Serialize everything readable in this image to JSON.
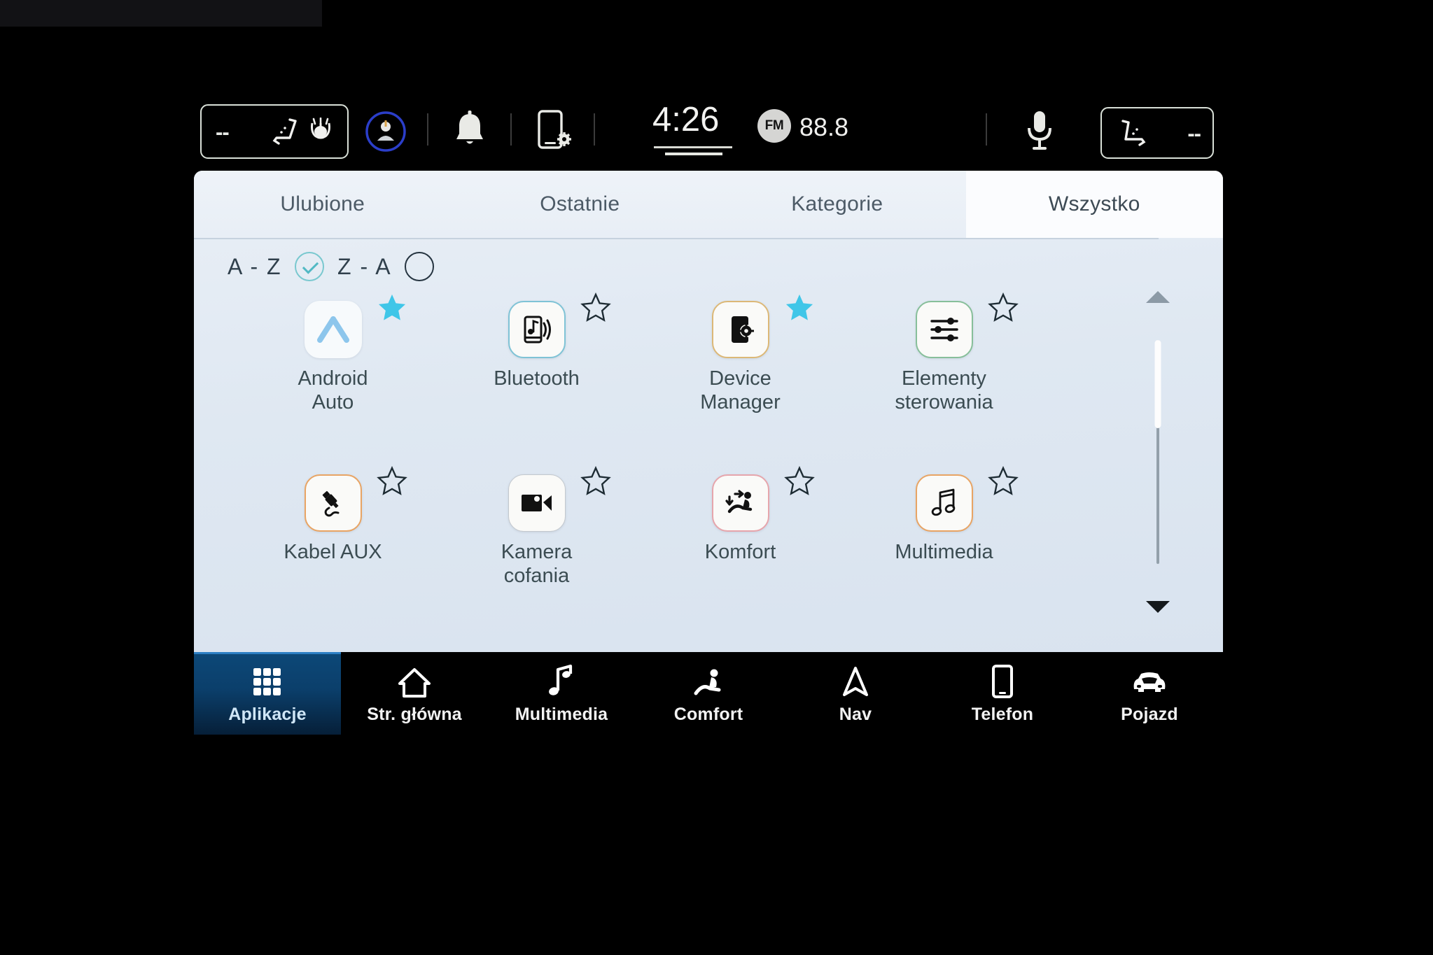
{
  "status_bar": {
    "left_seat_value": "--",
    "right_seat_value": "--",
    "left_seat_icon": "seat-heat-icon",
    "left_fan_icon": "seat-fan-icon",
    "profile_icon": "user-profile-icon",
    "bell_icon": "notification-bell-icon",
    "phone_settings_icon": "phone-settings-icon",
    "mic_icon": "microphone-icon",
    "right_seat_icon": "seat-climate-icon",
    "clock": "4:26",
    "radio_band": "FM",
    "radio_frequency": "88.8"
  },
  "tabs": [
    {
      "label": "Ulubione",
      "active": false
    },
    {
      "label": "Ostatnie",
      "active": false
    },
    {
      "label": "Kategorie",
      "active": false
    },
    {
      "label": "Wszystko",
      "active": true
    }
  ],
  "sort": {
    "az_label": "A - Z",
    "az_selected": true,
    "za_label": "Z - A",
    "za_selected": false
  },
  "apps": [
    {
      "label": "Android Auto",
      "label_line1": "Android",
      "label_line2": "Auto",
      "icon": "android-auto-icon",
      "favorite": true,
      "border": "none"
    },
    {
      "label": "Bluetooth",
      "label_line1": "Bluetooth",
      "label_line2": "",
      "icon": "bluetooth-audio-icon",
      "favorite": false,
      "border": "#7fc3d6"
    },
    {
      "label": "Device Manager",
      "label_line1": "Device",
      "label_line2": "Manager",
      "icon": "device-manager-icon",
      "favorite": true,
      "border": "#dcb877"
    },
    {
      "label": "Elementy sterowania",
      "label_line1": "Elementy",
      "label_line2": "sterowania",
      "icon": "controls-sliders-icon",
      "favorite": false,
      "border": "#87bf9a"
    },
    {
      "label": "Kabel AUX",
      "label_line1": "Kabel AUX",
      "label_line2": "",
      "icon": "aux-cable-icon",
      "favorite": false,
      "border": "#e8a464"
    },
    {
      "label": "Kamera cofania",
      "label_line1": "Kamera",
      "label_line2": "cofania",
      "icon": "rear-camera-icon",
      "favorite": false,
      "border": "#b9bdc2"
    },
    {
      "label": "Komfort",
      "label_line1": "Komfort",
      "label_line2": "",
      "icon": "comfort-seat-icon",
      "favorite": false,
      "border": "#e6a5ac"
    },
    {
      "label": "Multimedia",
      "label_line1": "Multimedia",
      "label_line2": "",
      "icon": "multimedia-notes-icon",
      "favorite": false,
      "border": "#e8a464"
    }
  ],
  "scrollbar": {
    "up_arrow": "scroll-up-arrow-icon",
    "down_arrow": "scroll-down-arrow-icon"
  },
  "nav_bar": [
    {
      "label": "Aplikacje",
      "icon": "apps-grid-icon",
      "active": true
    },
    {
      "label": "Str. główna",
      "icon": "home-icon",
      "active": false
    },
    {
      "label": "Multimedia",
      "icon": "music-note-icon",
      "active": false
    },
    {
      "label": "Comfort",
      "icon": "comfort-seat-icon",
      "active": false
    },
    {
      "label": "Nav",
      "icon": "navigation-arrow-icon",
      "active": false
    },
    {
      "label": "Telefon",
      "icon": "phone-icon",
      "active": false
    },
    {
      "label": "Pojazd",
      "icon": "car-icon",
      "active": false
    }
  ],
  "colors": {
    "favorite_star": "#3fc6e8",
    "accent_check": "#52b9c4",
    "active_nav": "#0d4878",
    "panel_bg": "#e3ebf4"
  }
}
